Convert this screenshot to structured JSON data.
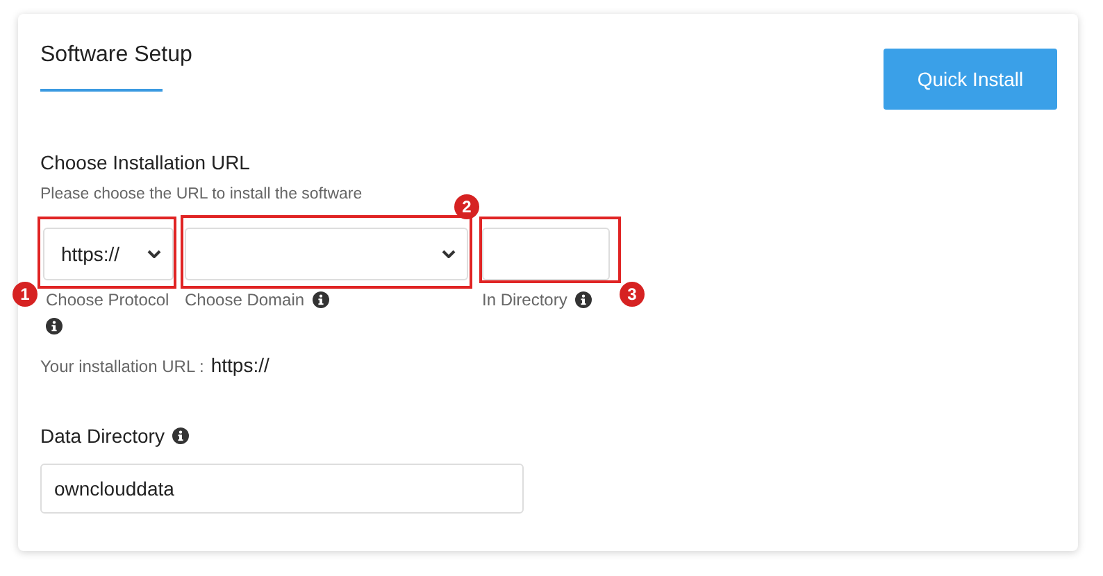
{
  "card": {
    "title": "Software Setup",
    "button": "Quick Install"
  },
  "url_section": {
    "heading": "Choose Installation URL",
    "hint": "Please choose the URL to install the software",
    "fields": [
      {
        "kind": "select",
        "value": "https://",
        "label": "Choose Protocol",
        "callout": "1"
      },
      {
        "kind": "select",
        "label": "Choose Domain",
        "callout": "2"
      },
      {
        "kind": "input",
        "label": "In Directory",
        "callout": "3"
      }
    ],
    "result_label": "Your installation URL :",
    "result_value": "https://"
  },
  "data_directory": {
    "label": "Data Directory",
    "value": "ownclouddata"
  }
}
